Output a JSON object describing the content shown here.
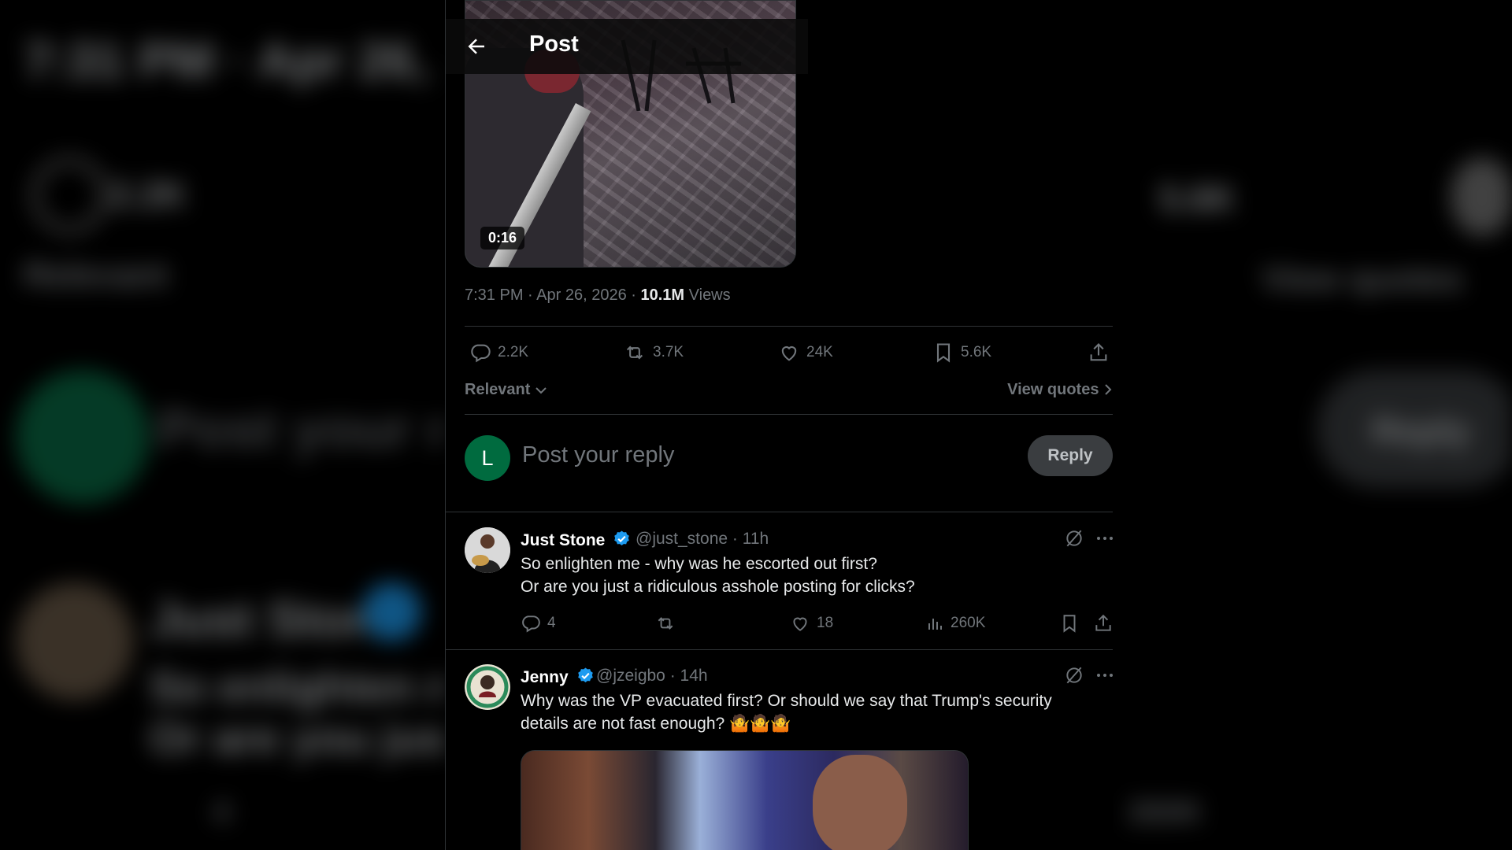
{
  "header": {
    "title": "Post"
  },
  "post": {
    "video_duration": "0:16",
    "time": "7:31 PM",
    "date": "Apr 26, 2026",
    "views_count": "10.1M",
    "views_label": "Views",
    "stats": {
      "replies": "2.2K",
      "reposts": "3.7K",
      "likes": "24K",
      "bookmarks": "5.6K"
    }
  },
  "sort": {
    "label": "Relevant",
    "view_quotes": "View quotes"
  },
  "composer": {
    "avatar_letter": "L",
    "placeholder": "Post your reply",
    "reply_button": "Reply"
  },
  "replies": [
    {
      "name": "Just Stone",
      "handle": "@just_stone",
      "age": "11h",
      "line1": "So enlighten me - why was he escorted out first?",
      "line2": "Or are you just a ridiculous asshole posting for clicks?",
      "replies": "4",
      "likes": "18",
      "views": "260K"
    },
    {
      "name": "Jenny",
      "handle": "@jzeigbo",
      "age": "14h",
      "line1": "Why was the VP evacuated first? Or should we say that Trump's security",
      "line2": "details are not fast enough? 🤷🤷🤷"
    }
  ],
  "background_text": {
    "left_date": "7:31 PM · Apr 26, 2026",
    "left_count": "2.2K",
    "left_sort": "Relevant",
    "left_reply": "Post your re",
    "left_name": "Just Stone",
    "left_line1": "So enlighten me",
    "left_line2": "Or are you just a",
    "left_small": "4",
    "right_count": "5.6K",
    "right_quotes": "View quotes",
    "right_reply": "Reply",
    "right_views": "260K"
  },
  "colors": {
    "accent_verified": "#1d9bf0",
    "composer_avatar": "#006b3f",
    "muted_text": "#71767b"
  }
}
